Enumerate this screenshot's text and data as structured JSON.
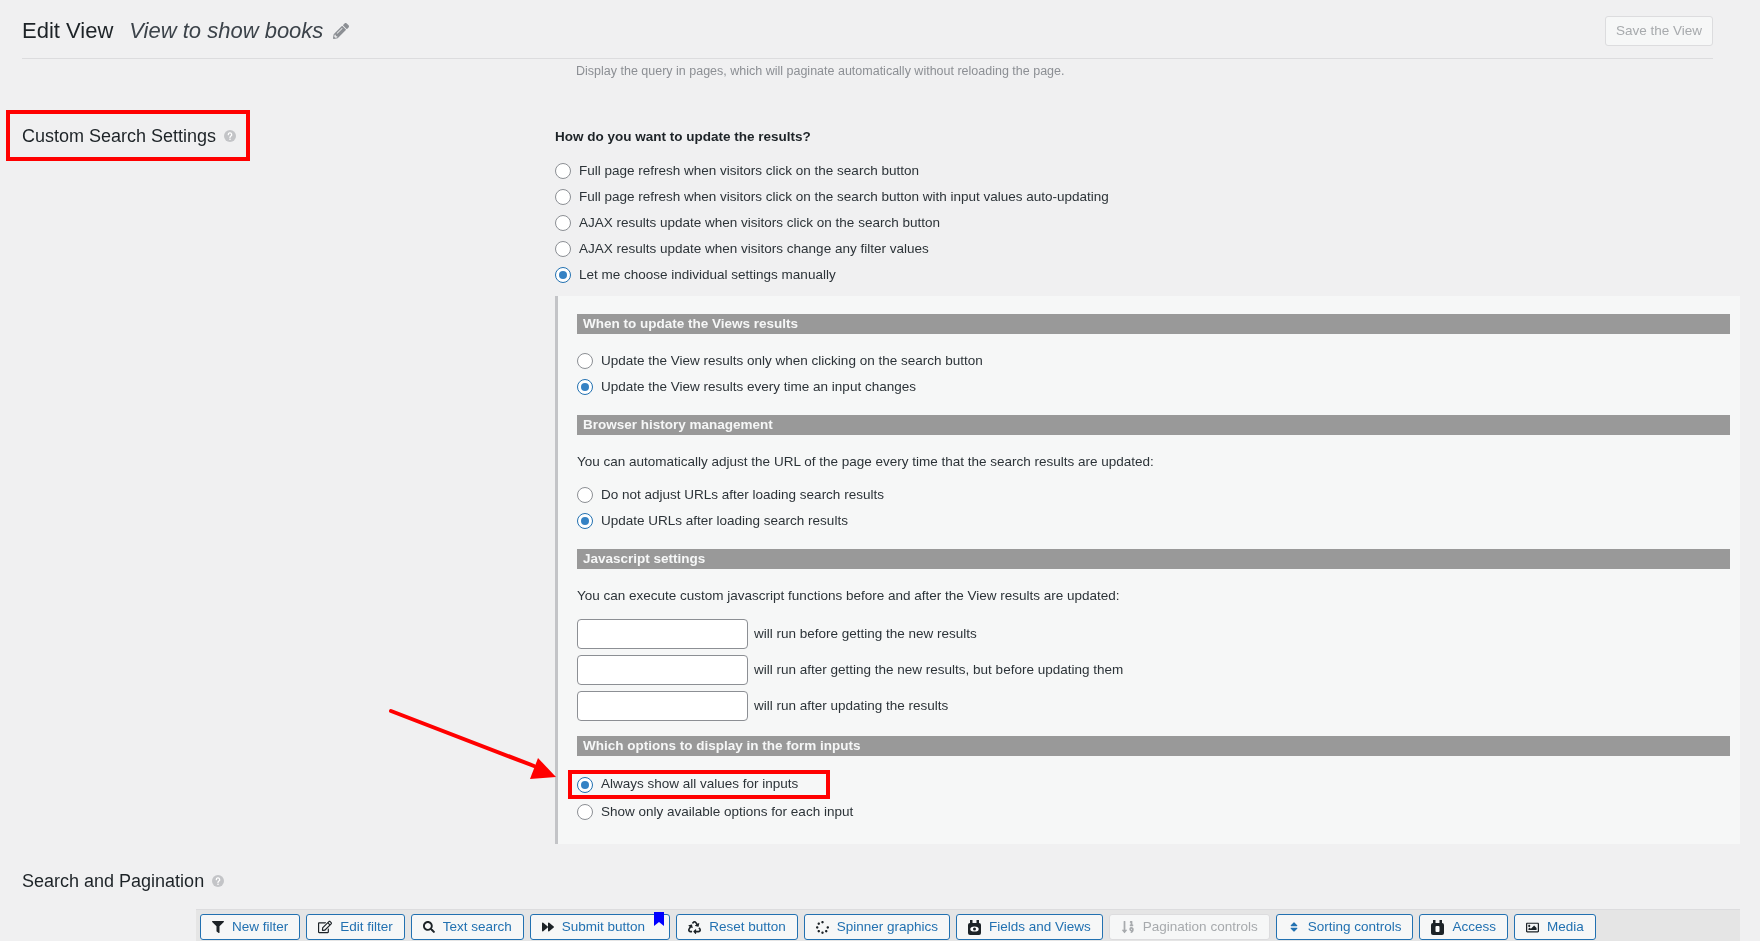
{
  "header": {
    "title": "Edit View",
    "view_name": "View to show books",
    "save_button": {
      "label": "Save the View",
      "disabled": true
    }
  },
  "pagination_hint": "Display the query in pages, which will paginate automatically without reloading the page.",
  "custom_search_settings": {
    "title": "Custom Search Settings",
    "highlighted": true,
    "question": "How do you want to update the results?",
    "options": [
      {
        "label": "Full page refresh when visitors click on the search button",
        "selected": false
      },
      {
        "label": "Full page refresh when visitors click on the search button with input values auto-updating",
        "selected": false
      },
      {
        "label": "AJAX results update when visitors click on the search button",
        "selected": false
      },
      {
        "label": "AJAX results update when visitors change any filter values",
        "selected": false
      },
      {
        "label": "Let me choose individual settings manually",
        "selected": true
      }
    ],
    "manual_sections": [
      {
        "title": "When to update the Views results",
        "blocks": [
          {
            "kind": "radio",
            "label": "Update the View results only when clicking on the search button",
            "selected": false,
            "highlighted": false,
            "arrow": false
          },
          {
            "kind": "radio",
            "label": "Update the View results every time an input changes",
            "selected": true,
            "highlighted": false,
            "arrow": false
          }
        ]
      },
      {
        "title": "Browser history management",
        "blocks": [
          {
            "kind": "note",
            "text": "You can automatically adjust the URL of the page every time that the search results are updated:"
          },
          {
            "kind": "radio",
            "label": "Do not adjust URLs after loading search results",
            "selected": false,
            "highlighted": false,
            "arrow": false
          },
          {
            "kind": "radio",
            "label": "Update URLs after loading search results",
            "selected": true,
            "highlighted": false,
            "arrow": false
          }
        ]
      },
      {
        "title": "Javascript settings",
        "blocks": [
          {
            "kind": "note",
            "text": "You can execute custom javascript functions before and after the View results are updated:"
          },
          {
            "kind": "function-field",
            "label": "will run before getting the new results"
          },
          {
            "kind": "function-field",
            "label": "will run after getting the new results, but before updating them"
          },
          {
            "kind": "function-field",
            "label": "will run after updating the results"
          }
        ]
      },
      {
        "title": "Which options to display in the form inputs",
        "blocks": [
          {
            "kind": "radio",
            "label": "Always show all values for inputs",
            "selected": true,
            "highlighted": true,
            "arrow": true
          },
          {
            "kind": "radio",
            "label": "Show only available options for each input",
            "selected": false,
            "highlighted": false,
            "arrow": false
          }
        ]
      }
    ]
  },
  "search_and_pagination": {
    "title": "Search and Pagination",
    "toolbar": [
      {
        "kind": "filter",
        "label": "New filter",
        "disabled": false,
        "bookmarked": false
      },
      {
        "kind": "edit",
        "label": "Edit filter",
        "disabled": false,
        "bookmarked": false
      },
      {
        "kind": "search",
        "label": "Text search",
        "disabled": false,
        "bookmarked": false
      },
      {
        "kind": "submit",
        "label": "Submit button",
        "disabled": false,
        "bookmarked": true
      },
      {
        "kind": "reset",
        "label": "Reset button",
        "disabled": false,
        "bookmarked": false
      },
      {
        "kind": "spinner",
        "label": "Spinner graphics",
        "disabled": false,
        "bookmarked": false
      },
      {
        "kind": "fields",
        "label": "Fields and Views",
        "disabled": false,
        "bookmarked": false
      },
      {
        "kind": "pagination",
        "label": "Pagination controls",
        "disabled": true,
        "bookmarked": false
      },
      {
        "kind": "sorting",
        "label": "Sorting controls",
        "disabled": false,
        "bookmarked": false
      },
      {
        "kind": "access",
        "label": "Access",
        "disabled": false,
        "bookmarked": false
      },
      {
        "kind": "media",
        "label": "Media",
        "disabled": false,
        "bookmarked": false
      }
    ]
  }
}
